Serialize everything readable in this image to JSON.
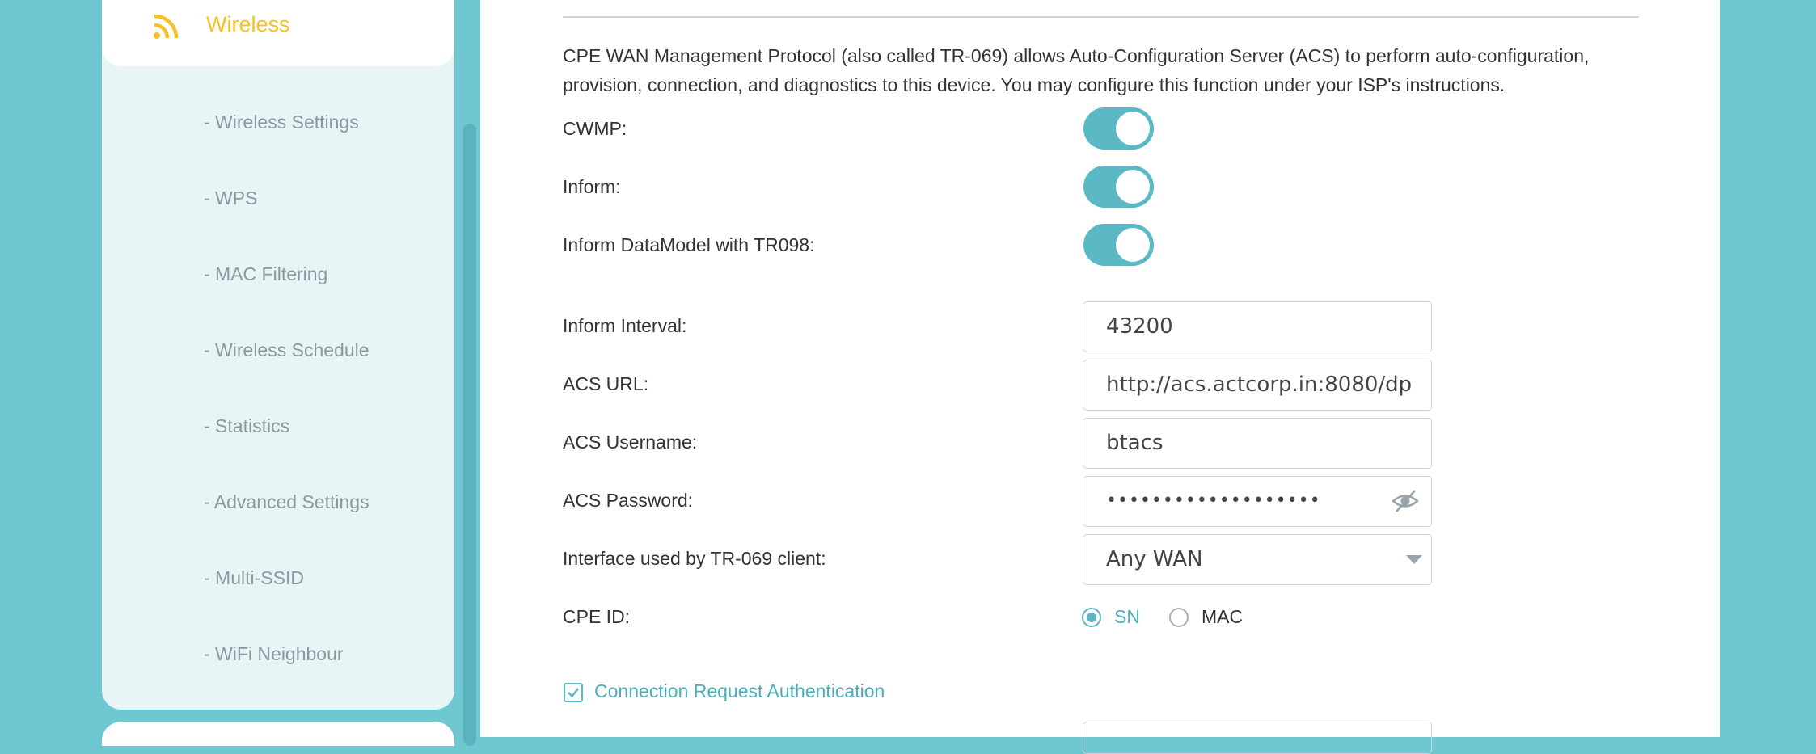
{
  "sidebar": {
    "active_section": "Wireless",
    "active_icon": "wifi-signal-icon",
    "items": [
      {
        "label": "- Wireless Settings"
      },
      {
        "label": "- WPS"
      },
      {
        "label": "- MAC Filtering"
      },
      {
        "label": "- Wireless Schedule"
      },
      {
        "label": "- Statistics"
      },
      {
        "label": "- Advanced Settings"
      },
      {
        "label": "- Multi-SSID"
      },
      {
        "label": "- WiFi Neighbour"
      }
    ]
  },
  "main": {
    "description": "CPE WAN Management Protocol (also called TR-069) allows Auto-Configuration Server (ACS) to perform auto-configuration, provision, connection, and diagnostics to this device. You may configure this function under your ISP's instructions.",
    "toggles": [
      {
        "label": "CWMP:",
        "on": true
      },
      {
        "label": "Inform:",
        "on": true
      },
      {
        "label": "Inform DataModel with TR098:",
        "on": true
      }
    ],
    "fields": {
      "inform_interval": {
        "label": "Inform Interval:",
        "value": "43200"
      },
      "acs_url": {
        "label": "ACS URL:",
        "value": "http://acs.actcorp.in:8080/dp"
      },
      "acs_username": {
        "label": "ACS Username:",
        "value": "btacs"
      },
      "acs_password": {
        "label": "ACS Password:",
        "value": "•••••••••••••••••••"
      },
      "interface": {
        "label": "Interface used by TR-069 client:",
        "value": "Any WAN"
      }
    },
    "cpe_id": {
      "label": "CPE ID:",
      "options": [
        "SN",
        "MAC"
      ],
      "selected": "SN"
    },
    "connection_request_auth": {
      "label": "Connection Request Authentication",
      "checked": true
    }
  },
  "colors": {
    "accent": "#5bb8c5",
    "active_nav": "#f6c122",
    "background": "#6fc7d2"
  }
}
